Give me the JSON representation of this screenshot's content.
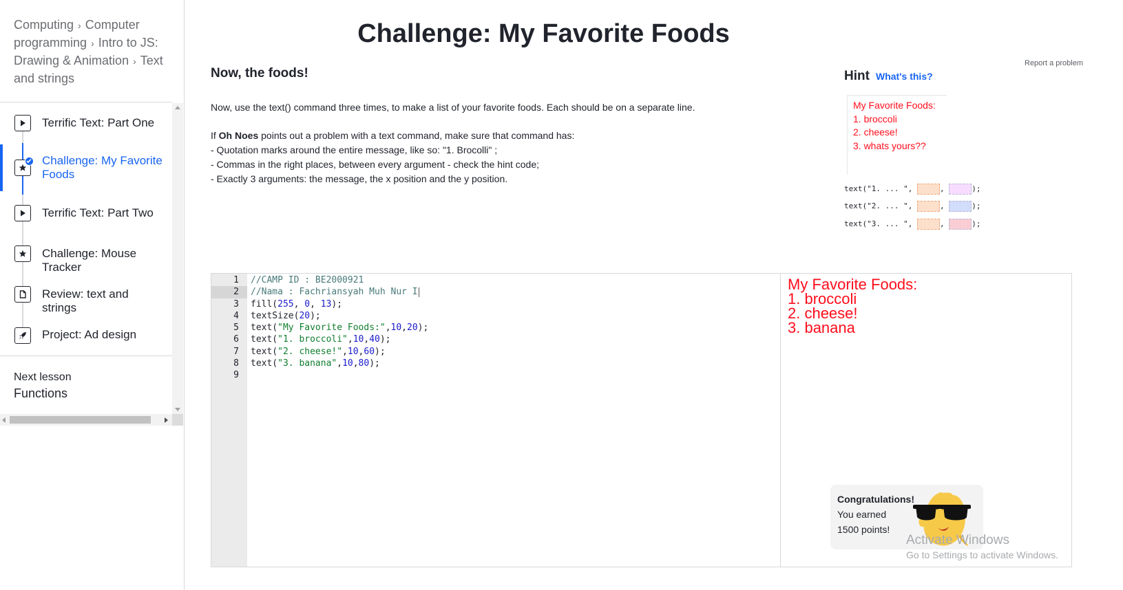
{
  "breadcrumb": {
    "items": [
      "Computing",
      "Computer programming",
      "Intro to JS: Drawing & Animation",
      "Text and strings"
    ],
    "separator": "›"
  },
  "lessons": [
    {
      "label": "Terrific Text: Part One",
      "icon": "play-icon",
      "active": false
    },
    {
      "label": "Challenge: My Favorite Foods",
      "icon": "star-icon",
      "active": true
    },
    {
      "label": "Terrific Text: Part Two",
      "icon": "play-icon",
      "active": false
    },
    {
      "label": "Challenge: Mouse Tracker",
      "icon": "star-icon",
      "active": false
    },
    {
      "label": "Review: text and strings",
      "icon": "document-icon",
      "active": false
    },
    {
      "label": "Project: Ad design",
      "icon": "rocket-icon",
      "active": false
    }
  ],
  "next_lesson": {
    "caption": "Next lesson",
    "title": "Functions"
  },
  "page": {
    "title": "Challenge: My Favorite Foods",
    "report_link": "Report a problem",
    "section_heading": "Now, the foods!",
    "instruction_1": "Now, use the text() command three times, to make a list of your favorite foods. Each should be on a separate line.",
    "instruction_2_prefix": "If ",
    "instruction_2_bold": "Oh Noes",
    "instruction_2_suffix": " points out a problem with a text command, make sure that command has:",
    "bullets": [
      "- Quotation marks around the entire message, like so: \"1. Brocolli\" ;",
      "- Commas in the right places, between every argument - check the hint code;",
      "- Exactly 3 arguments: the message, the x position and the y position."
    ]
  },
  "hint": {
    "title": "Hint",
    "link": "What's this?",
    "preview_lines": [
      "My Favorite Foods:",
      "1. broccoli",
      "2. cheese!",
      "3. whats yours??"
    ],
    "code_lines": [
      {
        "prefix": "text(\"1. ... \", ",
        "sep": ", ",
        "suffix": ");",
        "blank_colors": [
          "#fde0cc",
          "#f7dcff"
        ]
      },
      {
        "prefix": "text(\"2. ... \", ",
        "sep": ", ",
        "suffix": ");",
        "blank_colors": [
          "#fde0cc",
          "#d2dcfb"
        ]
      },
      {
        "prefix": "text(\"3. ... \", ",
        "sep": ", ",
        "suffix": ");",
        "blank_colors": [
          "#fde0cc",
          "#f9cdd3"
        ]
      }
    ]
  },
  "editor": {
    "current_line": 2,
    "lines": [
      "//CAMP ID : BE2000921",
      "//Nama : Fachriansyah Muh Nur I",
      "fill(255, 0, 13);",
      "textSize(20);",
      "text(\"My Favorite Foods:\",10,20);",
      "text(\"1. broccoli\",10,40);",
      "text(\"2. cheese!\",10,60);",
      "text(\"3. banana\",10,80);",
      ""
    ]
  },
  "output": {
    "lines": [
      "My Favorite Foods:",
      "1. broccoli",
      "2. cheese!",
      "3. banana"
    ],
    "color": "#ff0d1c"
  },
  "congrats": {
    "heading": "Congratulations!",
    "message": "You earned 1500 points!"
  },
  "watermark": {
    "title": "Activate Windows",
    "subtitle": "Go to Settings to activate Windows."
  },
  "colors": {
    "accent": "#1865f2",
    "text": "#21242c",
    "output_red": "#ff0d1c"
  }
}
